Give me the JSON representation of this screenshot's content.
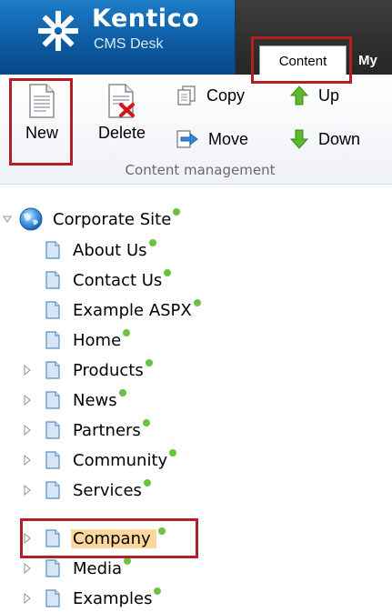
{
  "app": {
    "brand_name": "Kentico",
    "product": "CMS Desk"
  },
  "tabs": [
    {
      "label": "Content",
      "active": true
    },
    {
      "label": "My",
      "active": false
    }
  ],
  "ribbon": {
    "new_label": "New",
    "delete_label": "Delete",
    "copy_label": "Copy",
    "move_label": "Move",
    "up_label": "Up",
    "down_label": "Down",
    "group_label": "Content management"
  },
  "tree": {
    "root": {
      "label": "Corporate Site",
      "published": true,
      "expanded": true
    },
    "items": [
      {
        "label": "About Us",
        "expandable": false,
        "published": true
      },
      {
        "label": "Contact Us",
        "expandable": false,
        "published": true
      },
      {
        "label": "Example ASPX",
        "expandable": false,
        "published": true
      },
      {
        "label": "Home",
        "expandable": false,
        "published": true
      },
      {
        "label": "Products",
        "expandable": true,
        "published": true
      },
      {
        "label": "News",
        "expandable": true,
        "published": true
      },
      {
        "label": "Partners",
        "expandable": true,
        "published": true
      },
      {
        "label": "Community",
        "expandable": true,
        "published": true
      },
      {
        "label": "Services",
        "expandable": true,
        "published": true
      },
      {
        "label": "Company",
        "expandable": true,
        "published": true,
        "selected": true
      },
      {
        "label": "Media",
        "expandable": true,
        "published": true
      },
      {
        "label": "Examples",
        "expandable": true,
        "published": true
      }
    ]
  },
  "colors": {
    "brand_blue": "#0c5aa0",
    "header_dark": "#2f2f2f",
    "selected_bg": "#fdd79b",
    "published_dot": "#69c341",
    "callout_red": "#b21f24"
  }
}
